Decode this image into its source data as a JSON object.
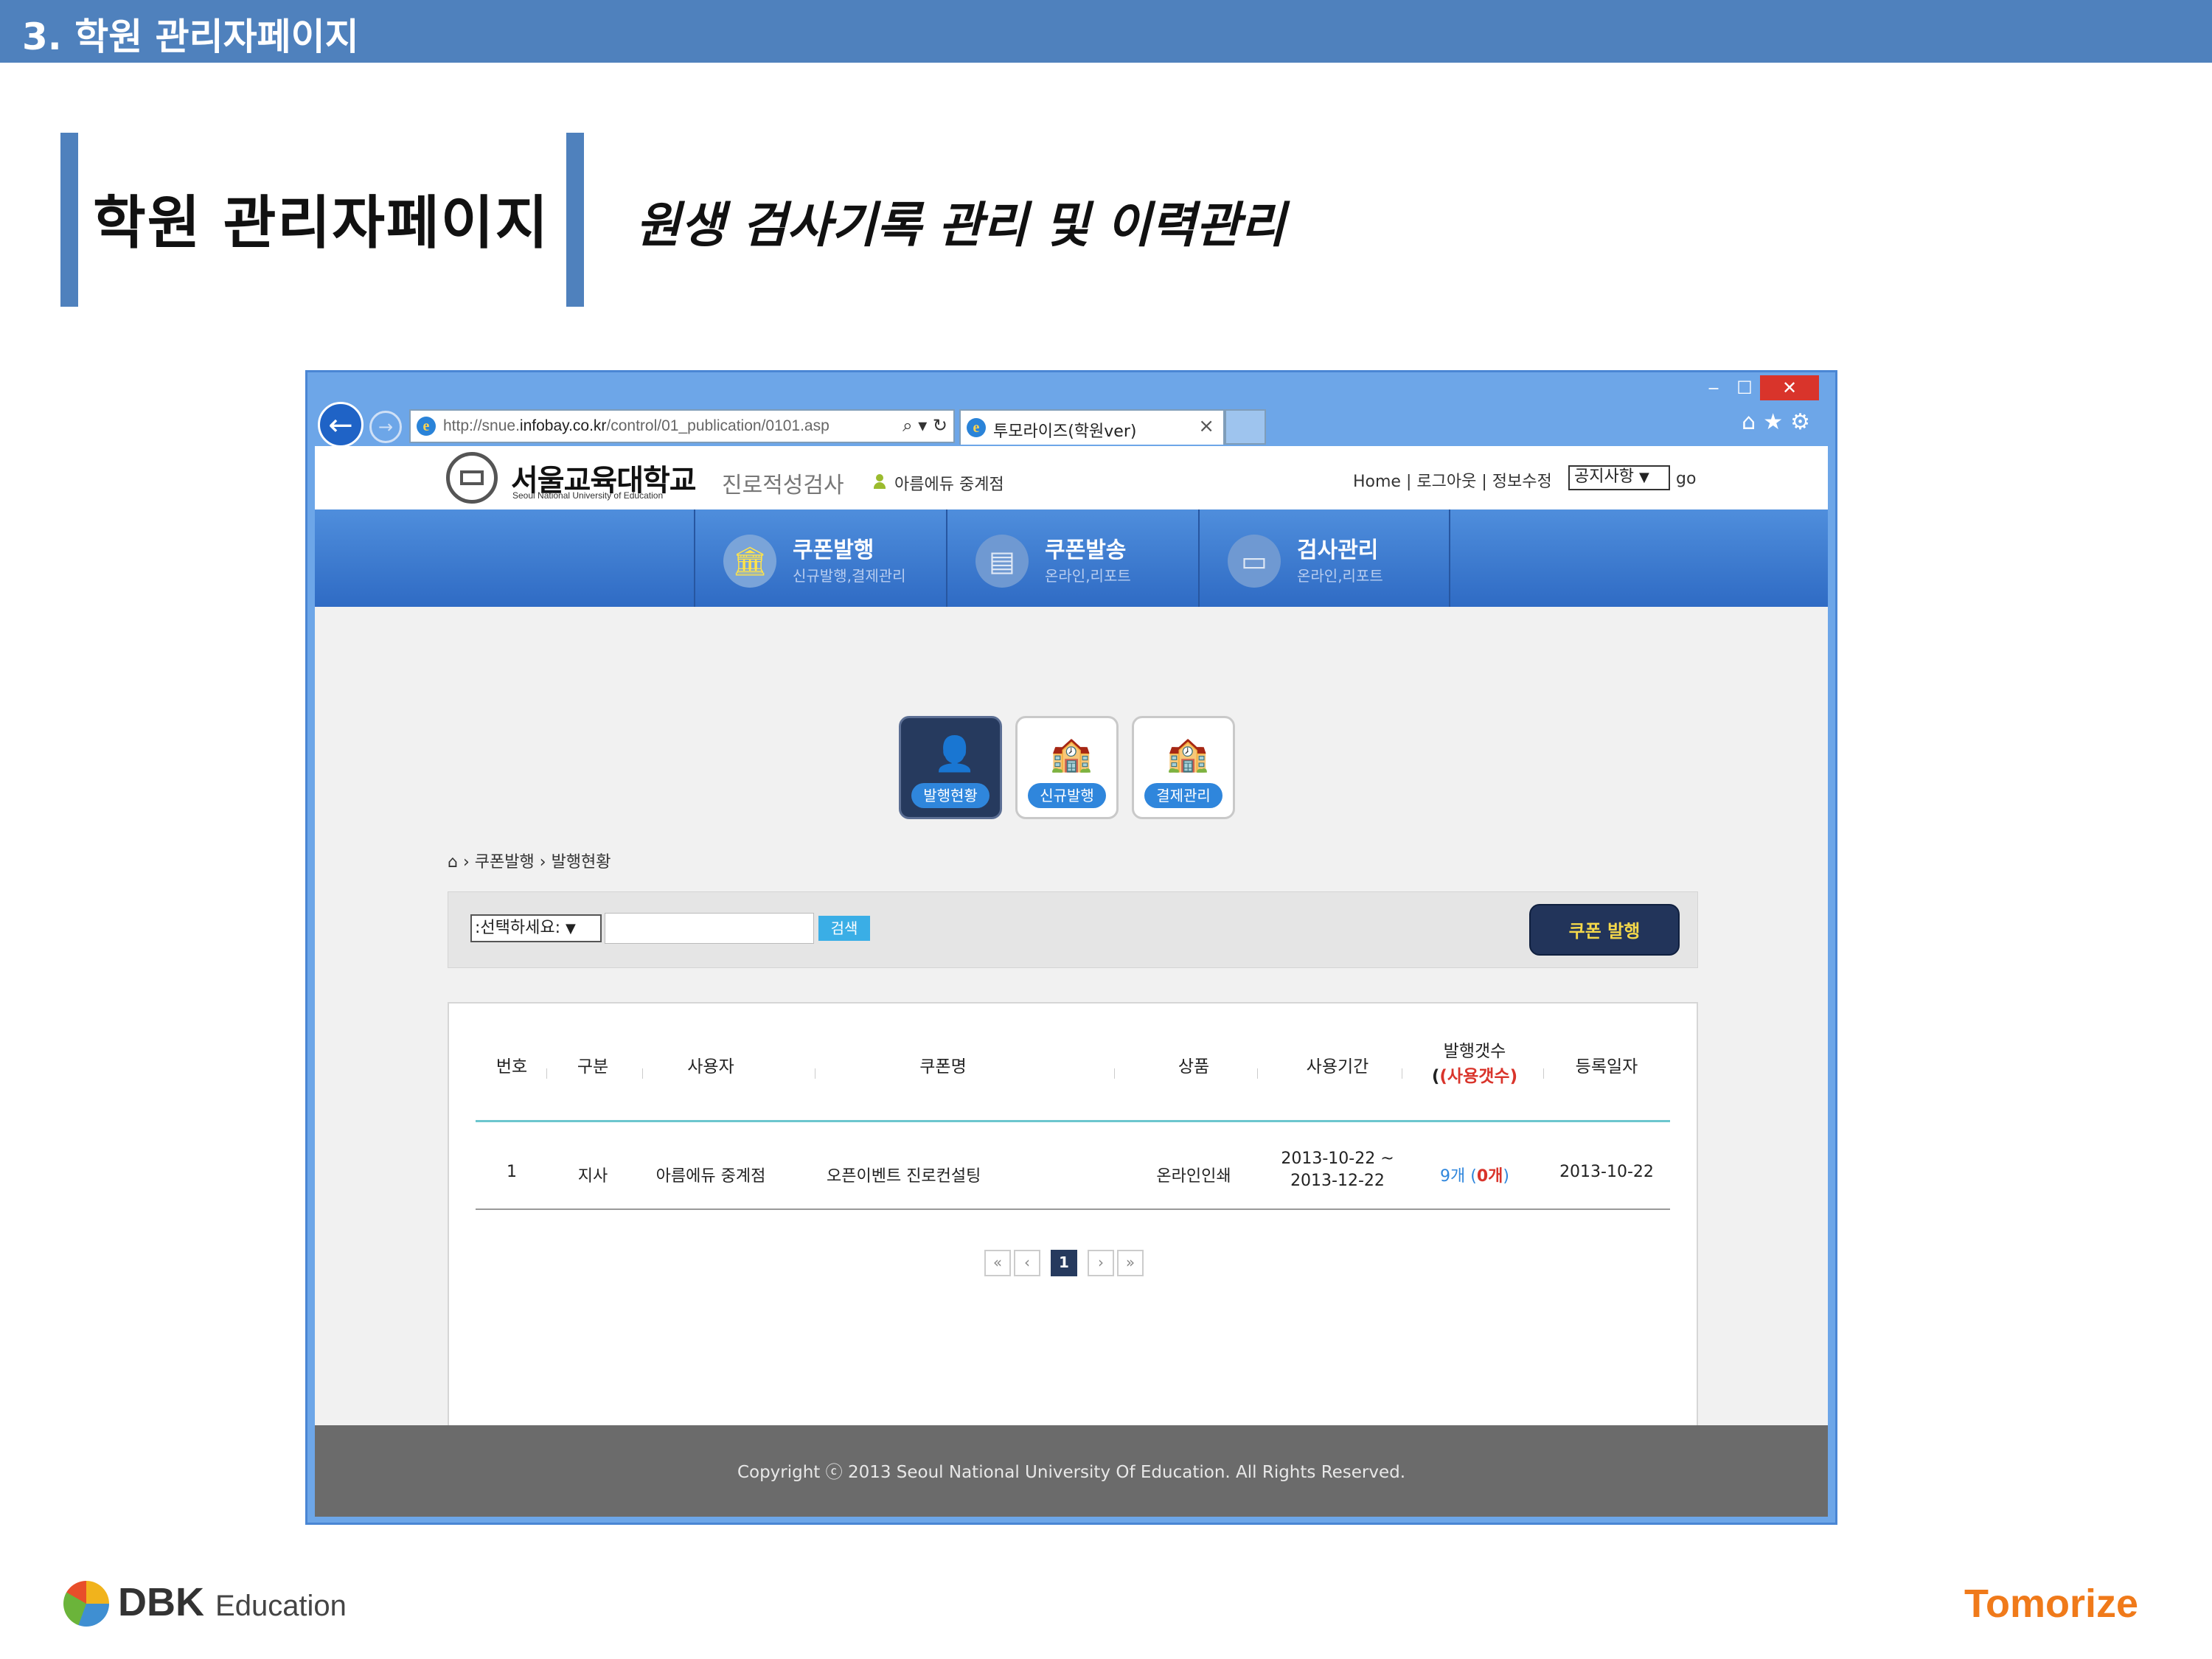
{
  "slide": {
    "section_title": "3. 학원 관리자페이지",
    "heading": "학원 관리자페이지",
    "subtitle": "원생 검사기록 관리 및 이력관리"
  },
  "browser": {
    "url_prefix": "http://snue.",
    "url_domain": "infobay.co.kr",
    "url_path": "/control/01_publication/0101.asp",
    "address_tools": "⌕ ▾ ↻",
    "tab_title": "투모라이즈(학원ver)",
    "tab_close": "×",
    "window_controls": {
      "minimize": "‒",
      "maximize": "☐",
      "close": "✕"
    },
    "toolbar_icons": [
      "home-icon",
      "star-icon",
      "gear-icon"
    ]
  },
  "site": {
    "university_name": "서울교육대학교",
    "university_name_en": "Seoul National University of Education",
    "service_name": "진로적성검사",
    "branch_name": "아름에듀 중계점",
    "header_links": "Home | 로그아웃 | 정보수정",
    "notice_select": "공지사항",
    "go": "go"
  },
  "main_nav": [
    {
      "title": "쿠폰발행",
      "sub": "신규발행,결제관리",
      "icon": "bank-icon"
    },
    {
      "title": "쿠폰발송",
      "sub": "온라인,리포트",
      "icon": "id-card-icon"
    },
    {
      "title": "검사관리",
      "sub": "온라인,리포트",
      "icon": "ticket-icon"
    }
  ],
  "sub_nav": [
    {
      "label": "발행현황",
      "icon": "person-icon",
      "active": true
    },
    {
      "label": "신규발행",
      "icon": "school-icon",
      "active": false
    },
    {
      "label": "결제관리",
      "icon": "school-icon",
      "active": false
    }
  ],
  "breadcrumb": {
    "level1": "쿠폰발행",
    "level2": "발행현황"
  },
  "search": {
    "select_value": ":선택하세요:",
    "input_value": "",
    "button_label": "검색"
  },
  "issue_button": "쿠폰 발행",
  "table": {
    "headers": {
      "no": "번호",
      "type": "구분",
      "user": "사용자",
      "coupon": "쿠폰명",
      "product": "상품",
      "period": "사용기간",
      "issued": "발행갯수",
      "used": "(사용갯수)",
      "date": "등록일자"
    },
    "rows": [
      {
        "no": "1",
        "type": "지사",
        "user": "아름에듀 중계점",
        "coupon": "오픈이벤트 진로컨설팅",
        "product": "온라인인쇄",
        "period_start": "2013-10-22 ~",
        "period_end": "2013-12-22",
        "issued": "9개",
        "used": "0개",
        "date": "2013-10-22"
      }
    ]
  },
  "pagination": {
    "first": "«",
    "prev": "‹",
    "current": "1",
    "next": "›",
    "last": "»"
  },
  "footer": "Copyright ⓒ 2013 Seoul National University Of Education. All Rights Reserved.",
  "logos": {
    "dbk": "DBK",
    "dbk_suffix": "Education",
    "tomorize": "Tomorize"
  },
  "colors": {
    "banner": "#4f81bd",
    "nav": "#2f6bc4",
    "active_tile": "#263a5e",
    "accent": "#2f86dc",
    "issued_count": "#2f86dc",
    "used_count": "#d9342b",
    "tomorize": "#f07a1a"
  }
}
